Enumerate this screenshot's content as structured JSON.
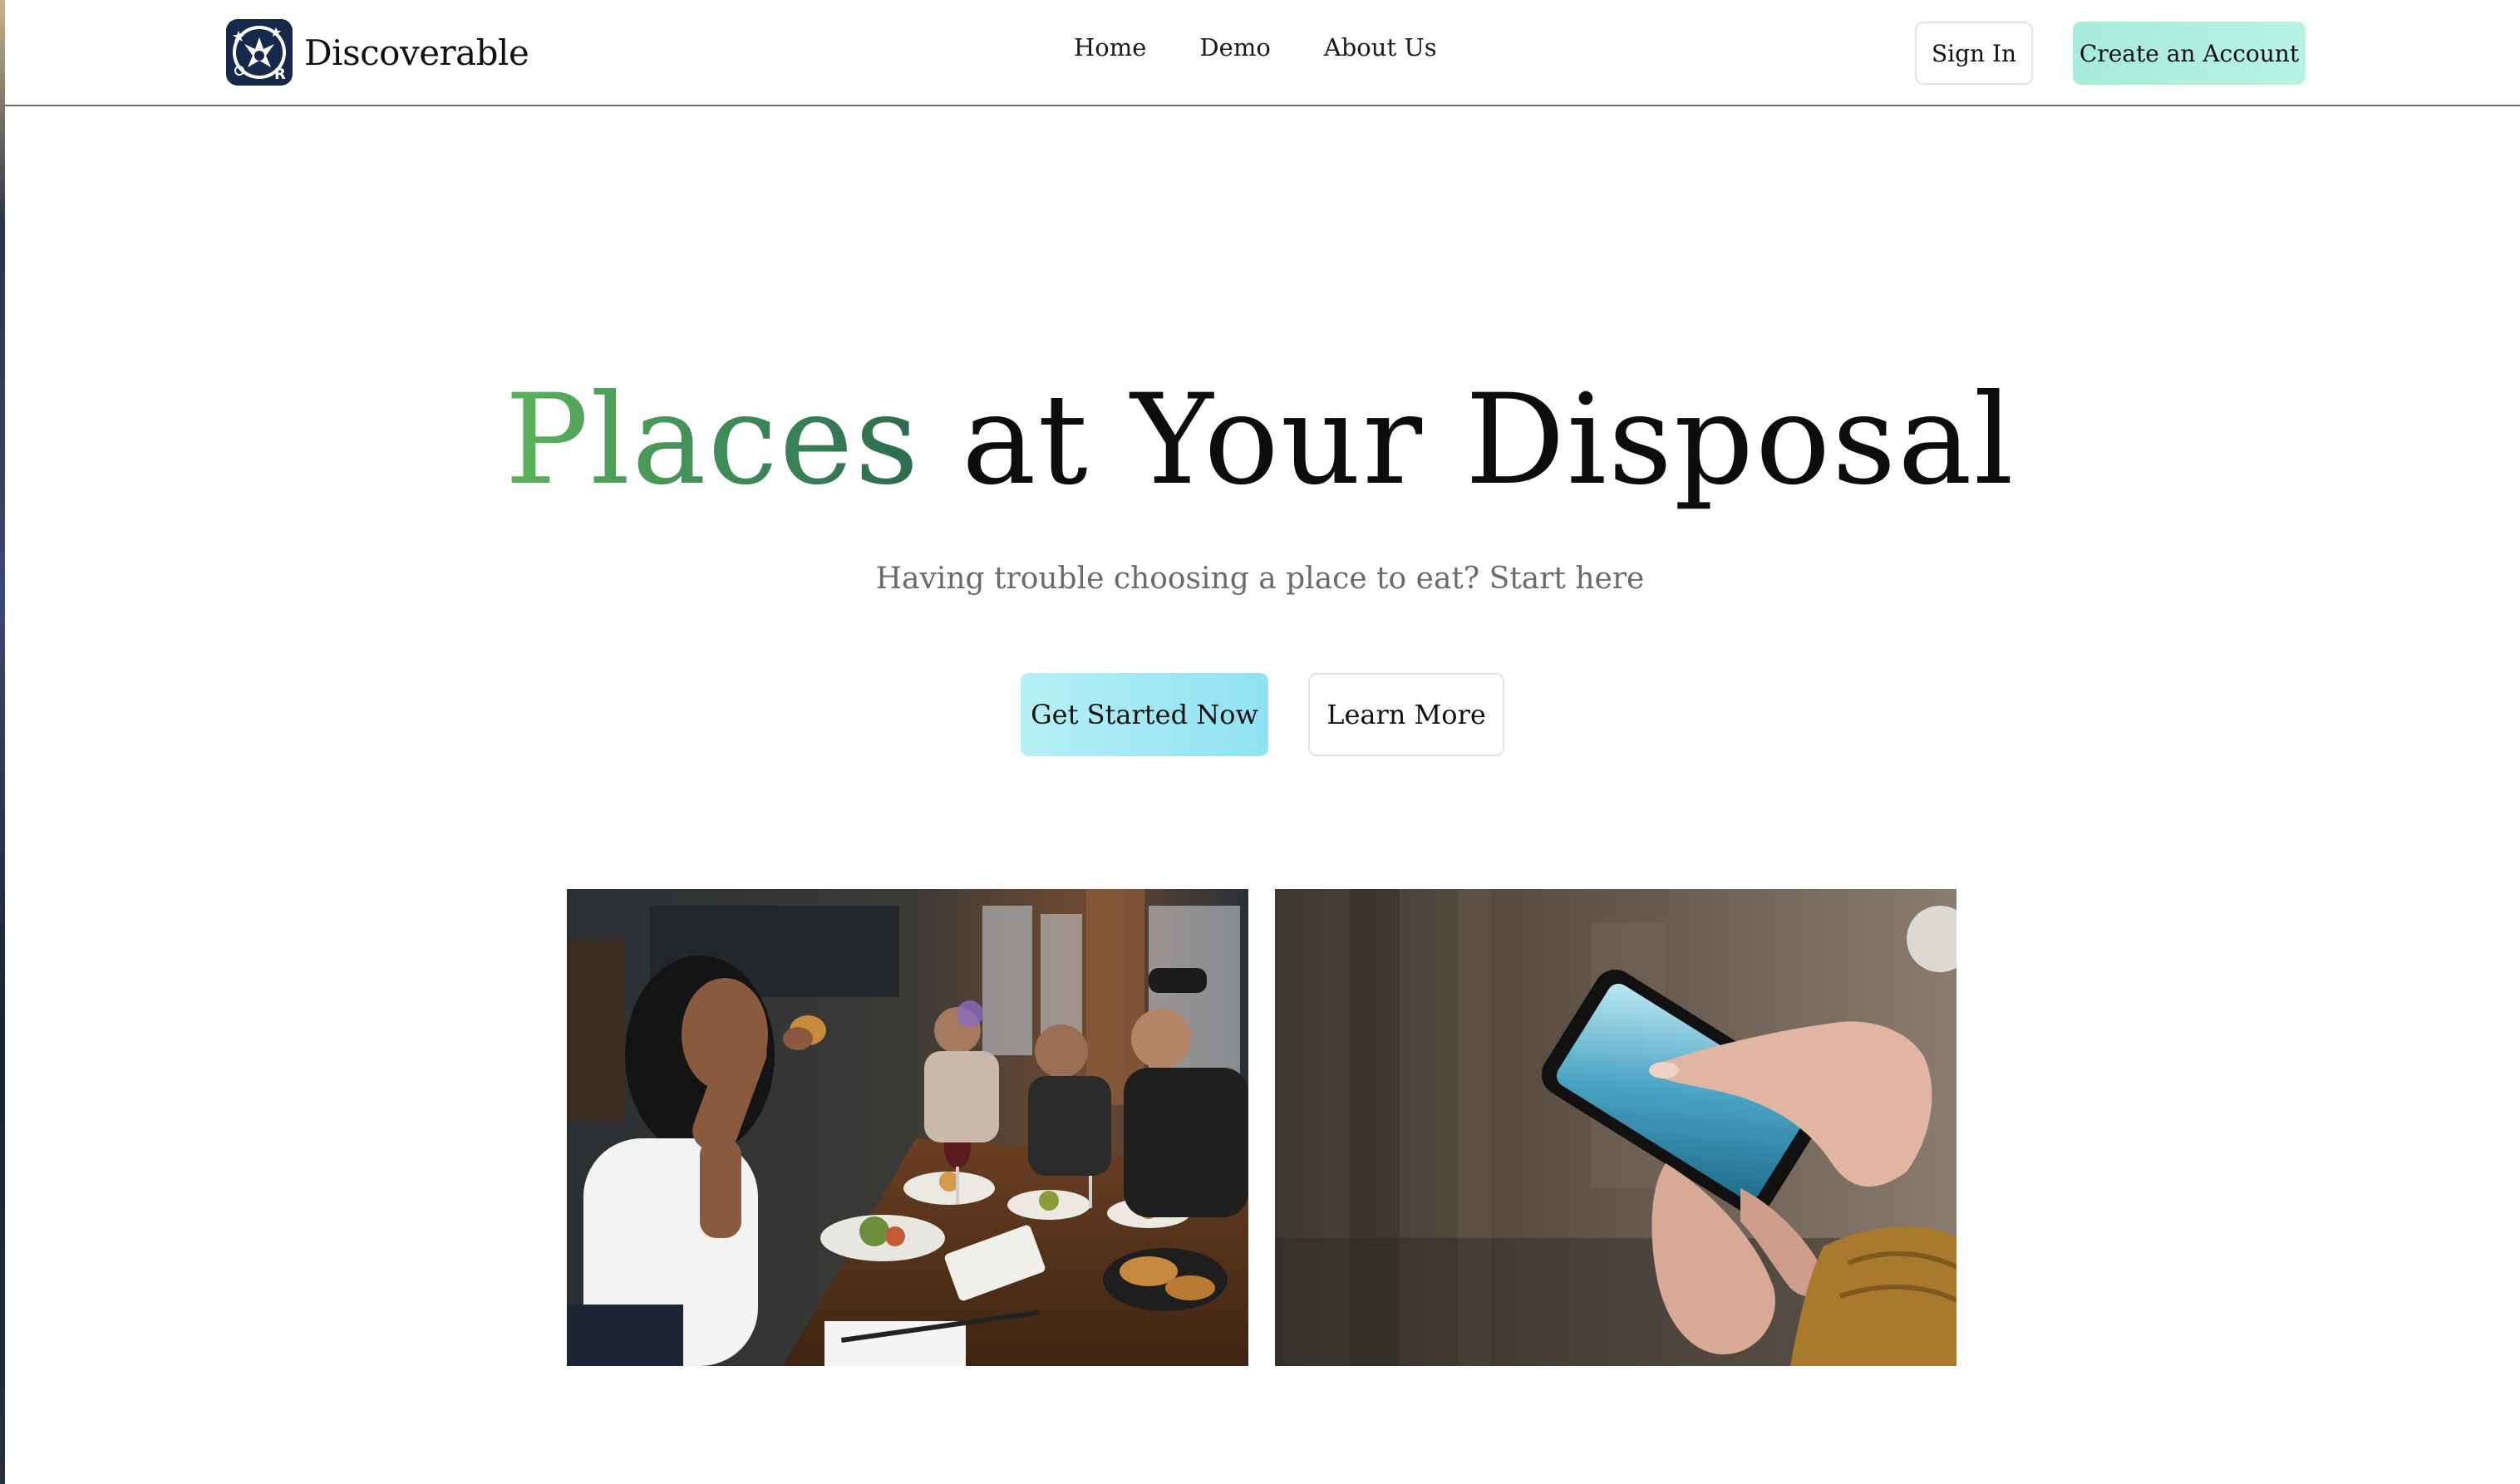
{
  "brand": {
    "name": "Discoverable",
    "logo_icon": "discoverable-logo-icon"
  },
  "nav": {
    "items": [
      {
        "label": "Home"
      },
      {
        "label": "Demo"
      },
      {
        "label": "About Us"
      }
    ]
  },
  "auth": {
    "sign_in_label": "Sign In",
    "create_account_label": "Create an Account"
  },
  "hero": {
    "title_accent": "Places",
    "title_rest": "at Your Disposal",
    "subtitle": "Having trouble choosing a place to eat? Start here",
    "primary_cta": "Get Started Now",
    "secondary_cta": "Learn More"
  },
  "images": {
    "left": "restaurant-dining-photo",
    "right": "smartphone-in-hands-photo"
  },
  "colors": {
    "accent_green": "#4a9d5a",
    "primary_button": "#a3ebf5",
    "create_button": "#b0efdf",
    "logo_bg": "#16294a"
  }
}
